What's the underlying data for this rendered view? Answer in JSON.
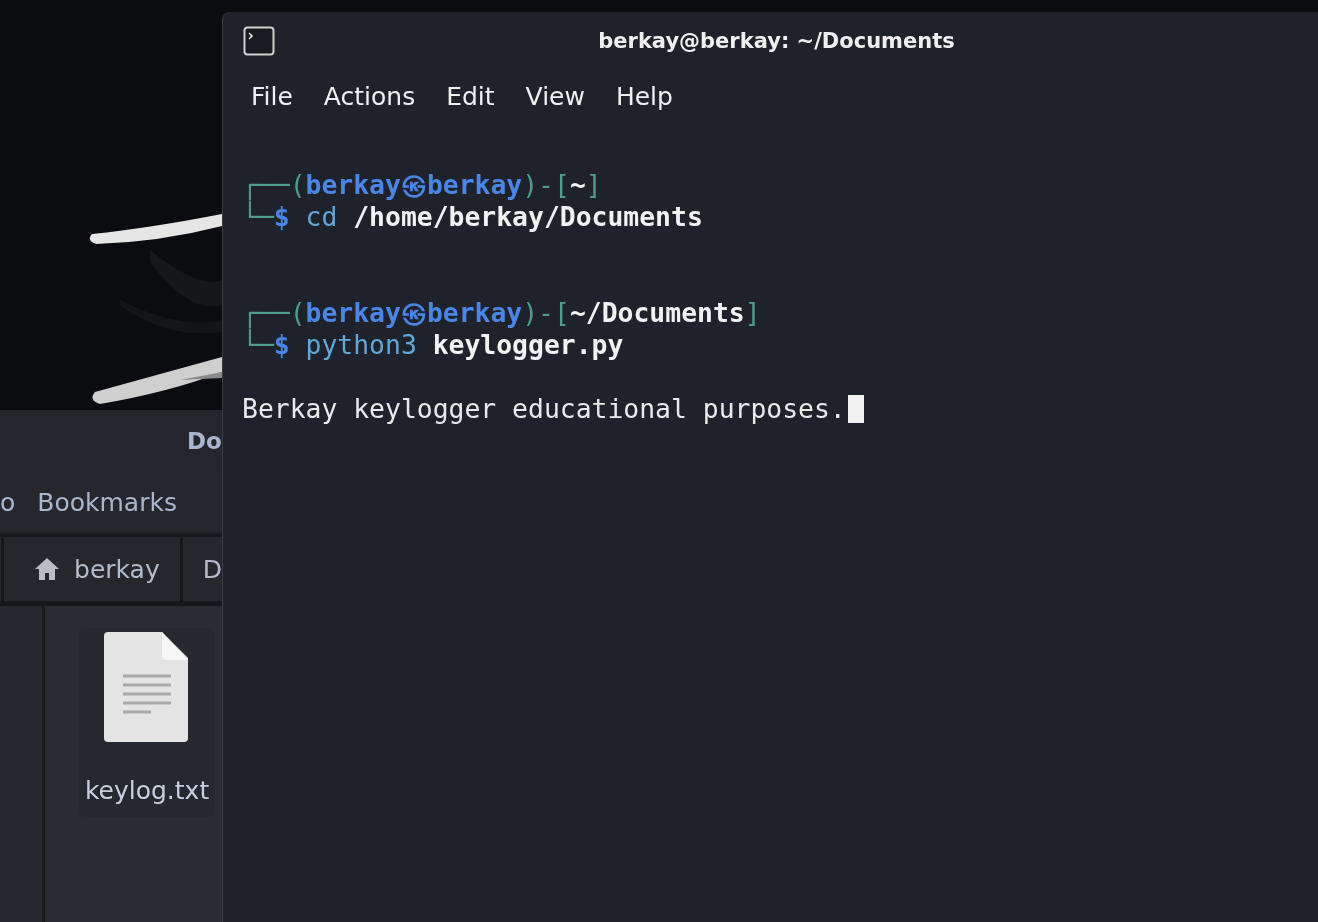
{
  "file_manager": {
    "title": "Do",
    "menu": [
      "o",
      "Bookmarks"
    ],
    "path": [
      {
        "label": "berkay",
        "kind": "home"
      },
      {
        "label": "D",
        "kind": "folder"
      }
    ],
    "files": [
      {
        "name": "keylog.txt",
        "kind": "text",
        "selected": false
      }
    ]
  },
  "terminal": {
    "title": "berkay@berkay: ~/Documents",
    "menu": [
      "File",
      "Actions",
      "Edit",
      "View",
      "Help"
    ],
    "lines": [
      [
        {
          "kind": "frame",
          "text": "┌──("
        },
        {
          "kind": "identity",
          "text": "berkay㉿berkay"
        },
        {
          "kind": "frame",
          "text": ")-["
        },
        {
          "kind": "path",
          "text": "~"
        },
        {
          "kind": "frame",
          "text": "]"
        }
      ],
      [
        {
          "kind": "frame",
          "text": "└─"
        },
        {
          "kind": "sigil",
          "text": "$"
        },
        {
          "kind": "command",
          "text": " cd"
        },
        {
          "kind": "path",
          "text": " /home/berkay/Documents"
        }
      ],
      [
        {
          "kind": "frame",
          "text": "┌──("
        },
        {
          "kind": "identity",
          "text": "berkay㉿berkay"
        },
        {
          "kind": "frame",
          "text": ")-["
        },
        {
          "kind": "path",
          "text": "~/Documents"
        },
        {
          "kind": "frame",
          "text": "]"
        }
      ],
      [
        {
          "kind": "frame",
          "text": "└─"
        },
        {
          "kind": "sigil",
          "text": "$"
        },
        {
          "kind": "command",
          "text": " python3"
        },
        {
          "kind": "path",
          "text": " keylogger.py"
        }
      ],
      [
        {
          "kind": "output",
          "text": "Berkay keylogger educational purposes."
        }
      ]
    ]
  }
}
